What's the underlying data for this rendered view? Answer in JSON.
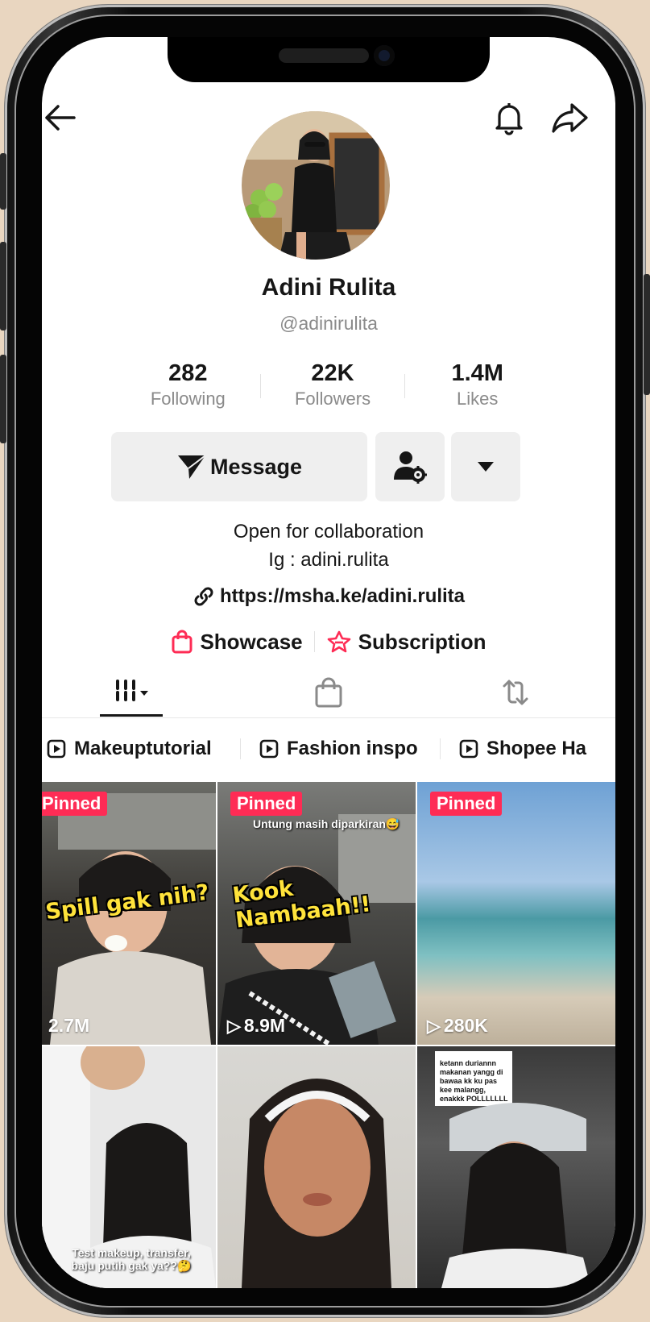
{
  "profile": {
    "name": "Adini Rulita",
    "handle": "@adinirulita",
    "stats": [
      {
        "value": "282",
        "label": "Following"
      },
      {
        "value": "22K",
        "label": "Followers"
      },
      {
        "value": "1.4M",
        "label": "Likes"
      }
    ],
    "message_label": "Message",
    "bio_line1": "Open for collaboration",
    "bio_line2": "Ig : adini.rulita",
    "link": "https://msha.ke/adini.rulita",
    "showcase_label": "Showcase",
    "subscription_label": "Subscription"
  },
  "playlists": [
    "Makeuptutorial",
    "Fashion inspo",
    "Shopee Ha"
  ],
  "videos": [
    {
      "pinned": "Pinned",
      "views": "2.7M",
      "overlay": "Spill gak nih?",
      "caption": ""
    },
    {
      "pinned": "Pinned",
      "views": "8.9M",
      "overlay": "Kook Nambaah!!",
      "caption": "Untung masih diparkiran😅"
    },
    {
      "pinned": "Pinned",
      "views": "280K",
      "overlay": "",
      "caption": ""
    },
    {
      "pinned": "",
      "views": "",
      "overlay": "",
      "caption": "Test makeup, transfer, baju putih gak ya??🤔"
    },
    {
      "pinned": "",
      "views": "",
      "overlay": "",
      "caption": ""
    },
    {
      "pinned": "",
      "views": "",
      "overlay": "",
      "caption": "ketann duriannn makanan yangg di bawaa kk ku pas kee malangg, enakkk POLLLLLLL"
    }
  ],
  "colors": {
    "accent": "#fe2c55",
    "text": "#161616",
    "muted": "#8a8a8a",
    "button_bg": "#efefef"
  },
  "icons": [
    "back-arrow-icon",
    "bell-icon",
    "share-icon",
    "send-icon",
    "add-user-settings-icon",
    "caret-down-icon",
    "link-icon",
    "shopping-bag-icon",
    "subscription-star-icon",
    "grid-icon",
    "bag-tab-icon",
    "repost-icon",
    "play-icon"
  ]
}
